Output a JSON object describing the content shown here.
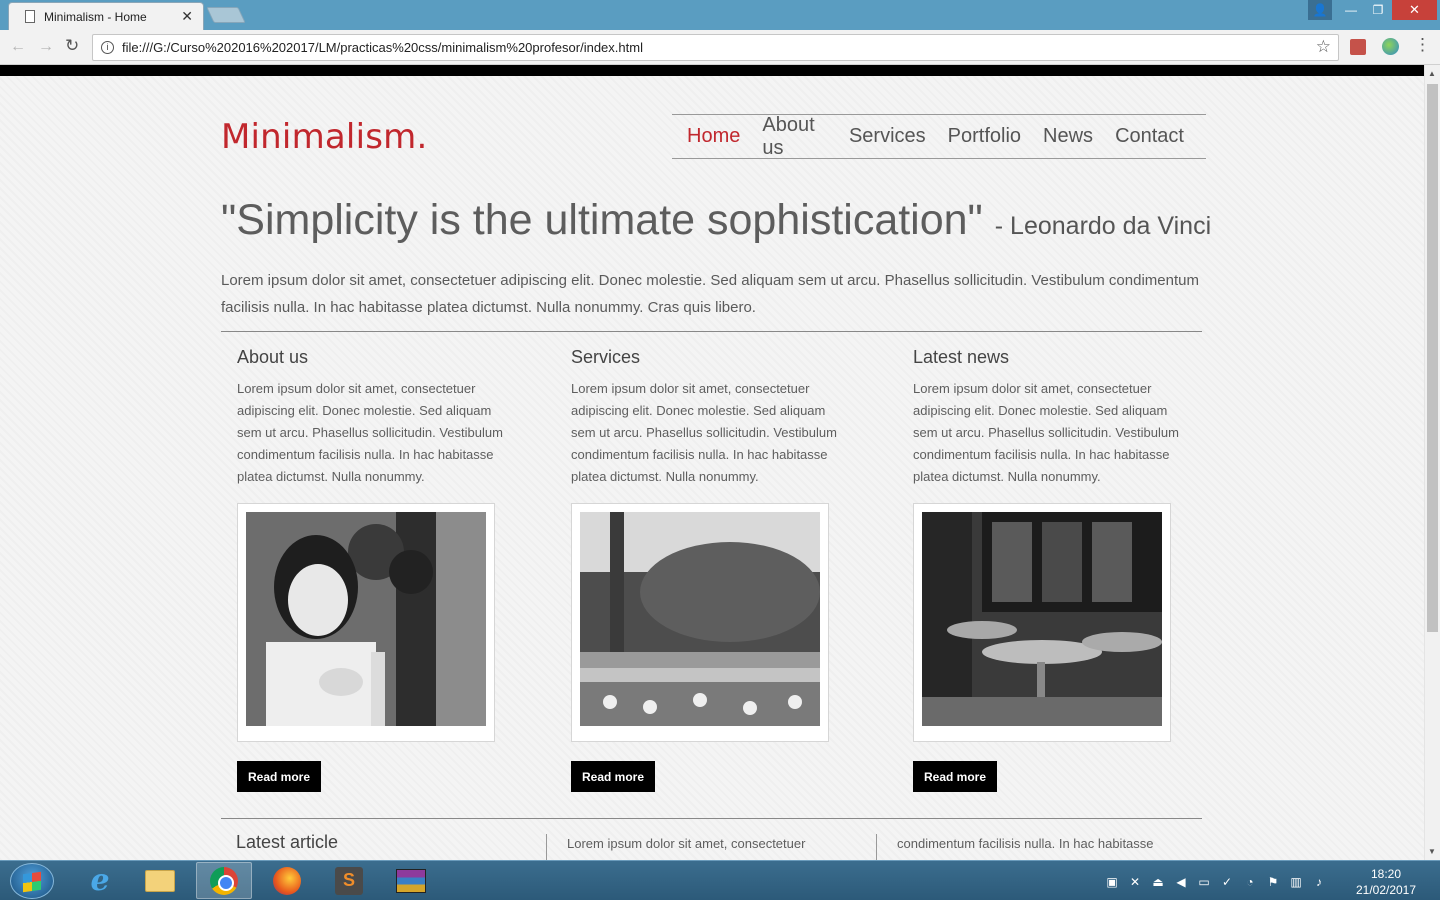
{
  "browser": {
    "tab_title": "Minimalism - Home",
    "url": "file:///G:/Curso%202016%202017/LM/practicas%20css/minimalism%20profesor/index.html"
  },
  "site": {
    "brand": "Minimalism.",
    "nav": [
      "Home",
      "About us",
      "Services",
      "Portfolio",
      "News",
      "Contact"
    ],
    "active_nav": "Home",
    "quote": "\"Simplicity is the ultimate sophistication\"",
    "quote_author": "- Leonardo da Vinci",
    "intro": "Lorem ipsum dolor sit amet, consectetuer adipiscing elit. Donec molestie. Sed aliquam sem ut arcu. Phasellus sollicitudin. Vestibulum condimentum facilisis nulla. In hac habitasse platea dictumst. Nulla nonummy. Cras quis libero.",
    "columns": [
      {
        "title": "About us",
        "text": "Lorem ipsum dolor sit amet, consectetuer adipiscing elit. Donec molestie. Sed aliquam sem ut arcu. Phasellus sollicitudin. Vestibulum condimentum facilisis nulla. In hac habitasse platea dictumst. Nulla nonummy.",
        "button": "Read more"
      },
      {
        "title": "Services",
        "text": "Lorem ipsum dolor sit amet, consectetuer adipiscing elit. Donec molestie. Sed aliquam sem ut arcu. Phasellus sollicitudin. Vestibulum condimentum facilisis nulla. In hac habitasse platea dictumst. Nulla nonummy.",
        "button": "Read more"
      },
      {
        "title": "Latest news",
        "text": "Lorem ipsum dolor sit amet, consectetuer adipiscing elit. Donec molestie. Sed aliquam sem ut arcu. Phasellus sollicitudin. Vestibulum condimentum facilisis nulla. In hac habitasse platea dictumst. Nulla nonummy.",
        "button": "Read more"
      }
    ],
    "latest_article_title": "Latest article",
    "latest_article_col1": "Lorem ipsum dolor sit amet, consectetuer",
    "latest_article_col2": "condimentum facilisis nulla. In hac habitasse"
  },
  "taskbar": {
    "time": "18:20",
    "date": "21/02/2017"
  },
  "colors": {
    "accent": "#c1272d",
    "titlebar": "#5a9dc1",
    "taskbar": "#2f5f80"
  }
}
